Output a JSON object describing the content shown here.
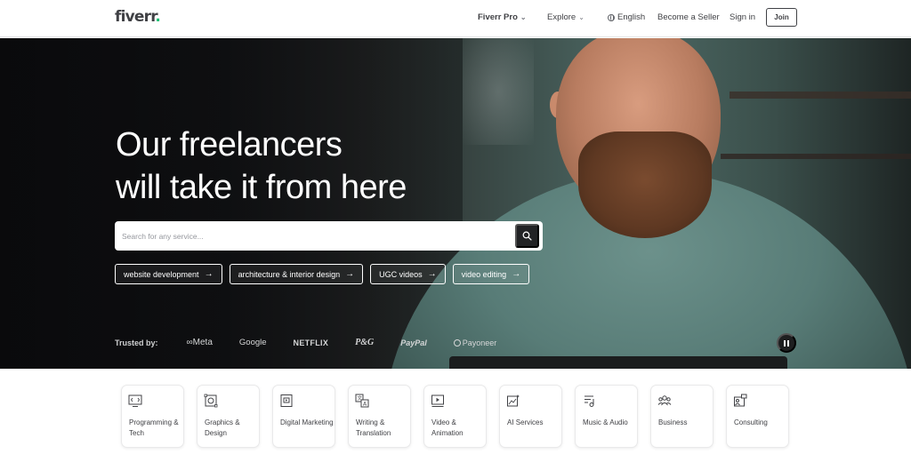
{
  "header": {
    "logo": "fiverr",
    "logo_dot": ".",
    "nav": {
      "fiverr_pro": "Fiverr Pro",
      "explore": "Explore",
      "language": "English",
      "become_seller": "Become a Seller",
      "sign_in": "Sign in",
      "join": "Join"
    }
  },
  "hero": {
    "title_line1": "Our freelancers",
    "title_line2": "will take it from here",
    "search_placeholder": "Search for any service...",
    "chips": [
      "website development",
      "architecture & interior design",
      "UGC videos",
      "video editing"
    ],
    "trusted_label": "Trusted by:",
    "brands": [
      "Meta",
      "Google",
      "NETFLIX",
      "P&G",
      "PayPal",
      "Payoneer"
    ]
  },
  "categories": [
    {
      "label": "Programming & Tech",
      "icon": "programming-icon"
    },
    {
      "label": "Graphics & Design",
      "icon": "graphics-icon"
    },
    {
      "label": "Digital Marketing",
      "icon": "marketing-icon"
    },
    {
      "label": "Writing & Translation",
      "icon": "translation-icon"
    },
    {
      "label": "Video & Animation",
      "icon": "video-icon"
    },
    {
      "label": "AI Services",
      "icon": "ai-icon"
    },
    {
      "label": "Music & Audio",
      "icon": "music-icon"
    },
    {
      "label": "Business",
      "icon": "business-icon"
    },
    {
      "label": "Consulting",
      "icon": "consulting-icon"
    }
  ],
  "colors": {
    "brand_green": "#1dbf73",
    "text": "#404145",
    "search_button": "#222325"
  }
}
